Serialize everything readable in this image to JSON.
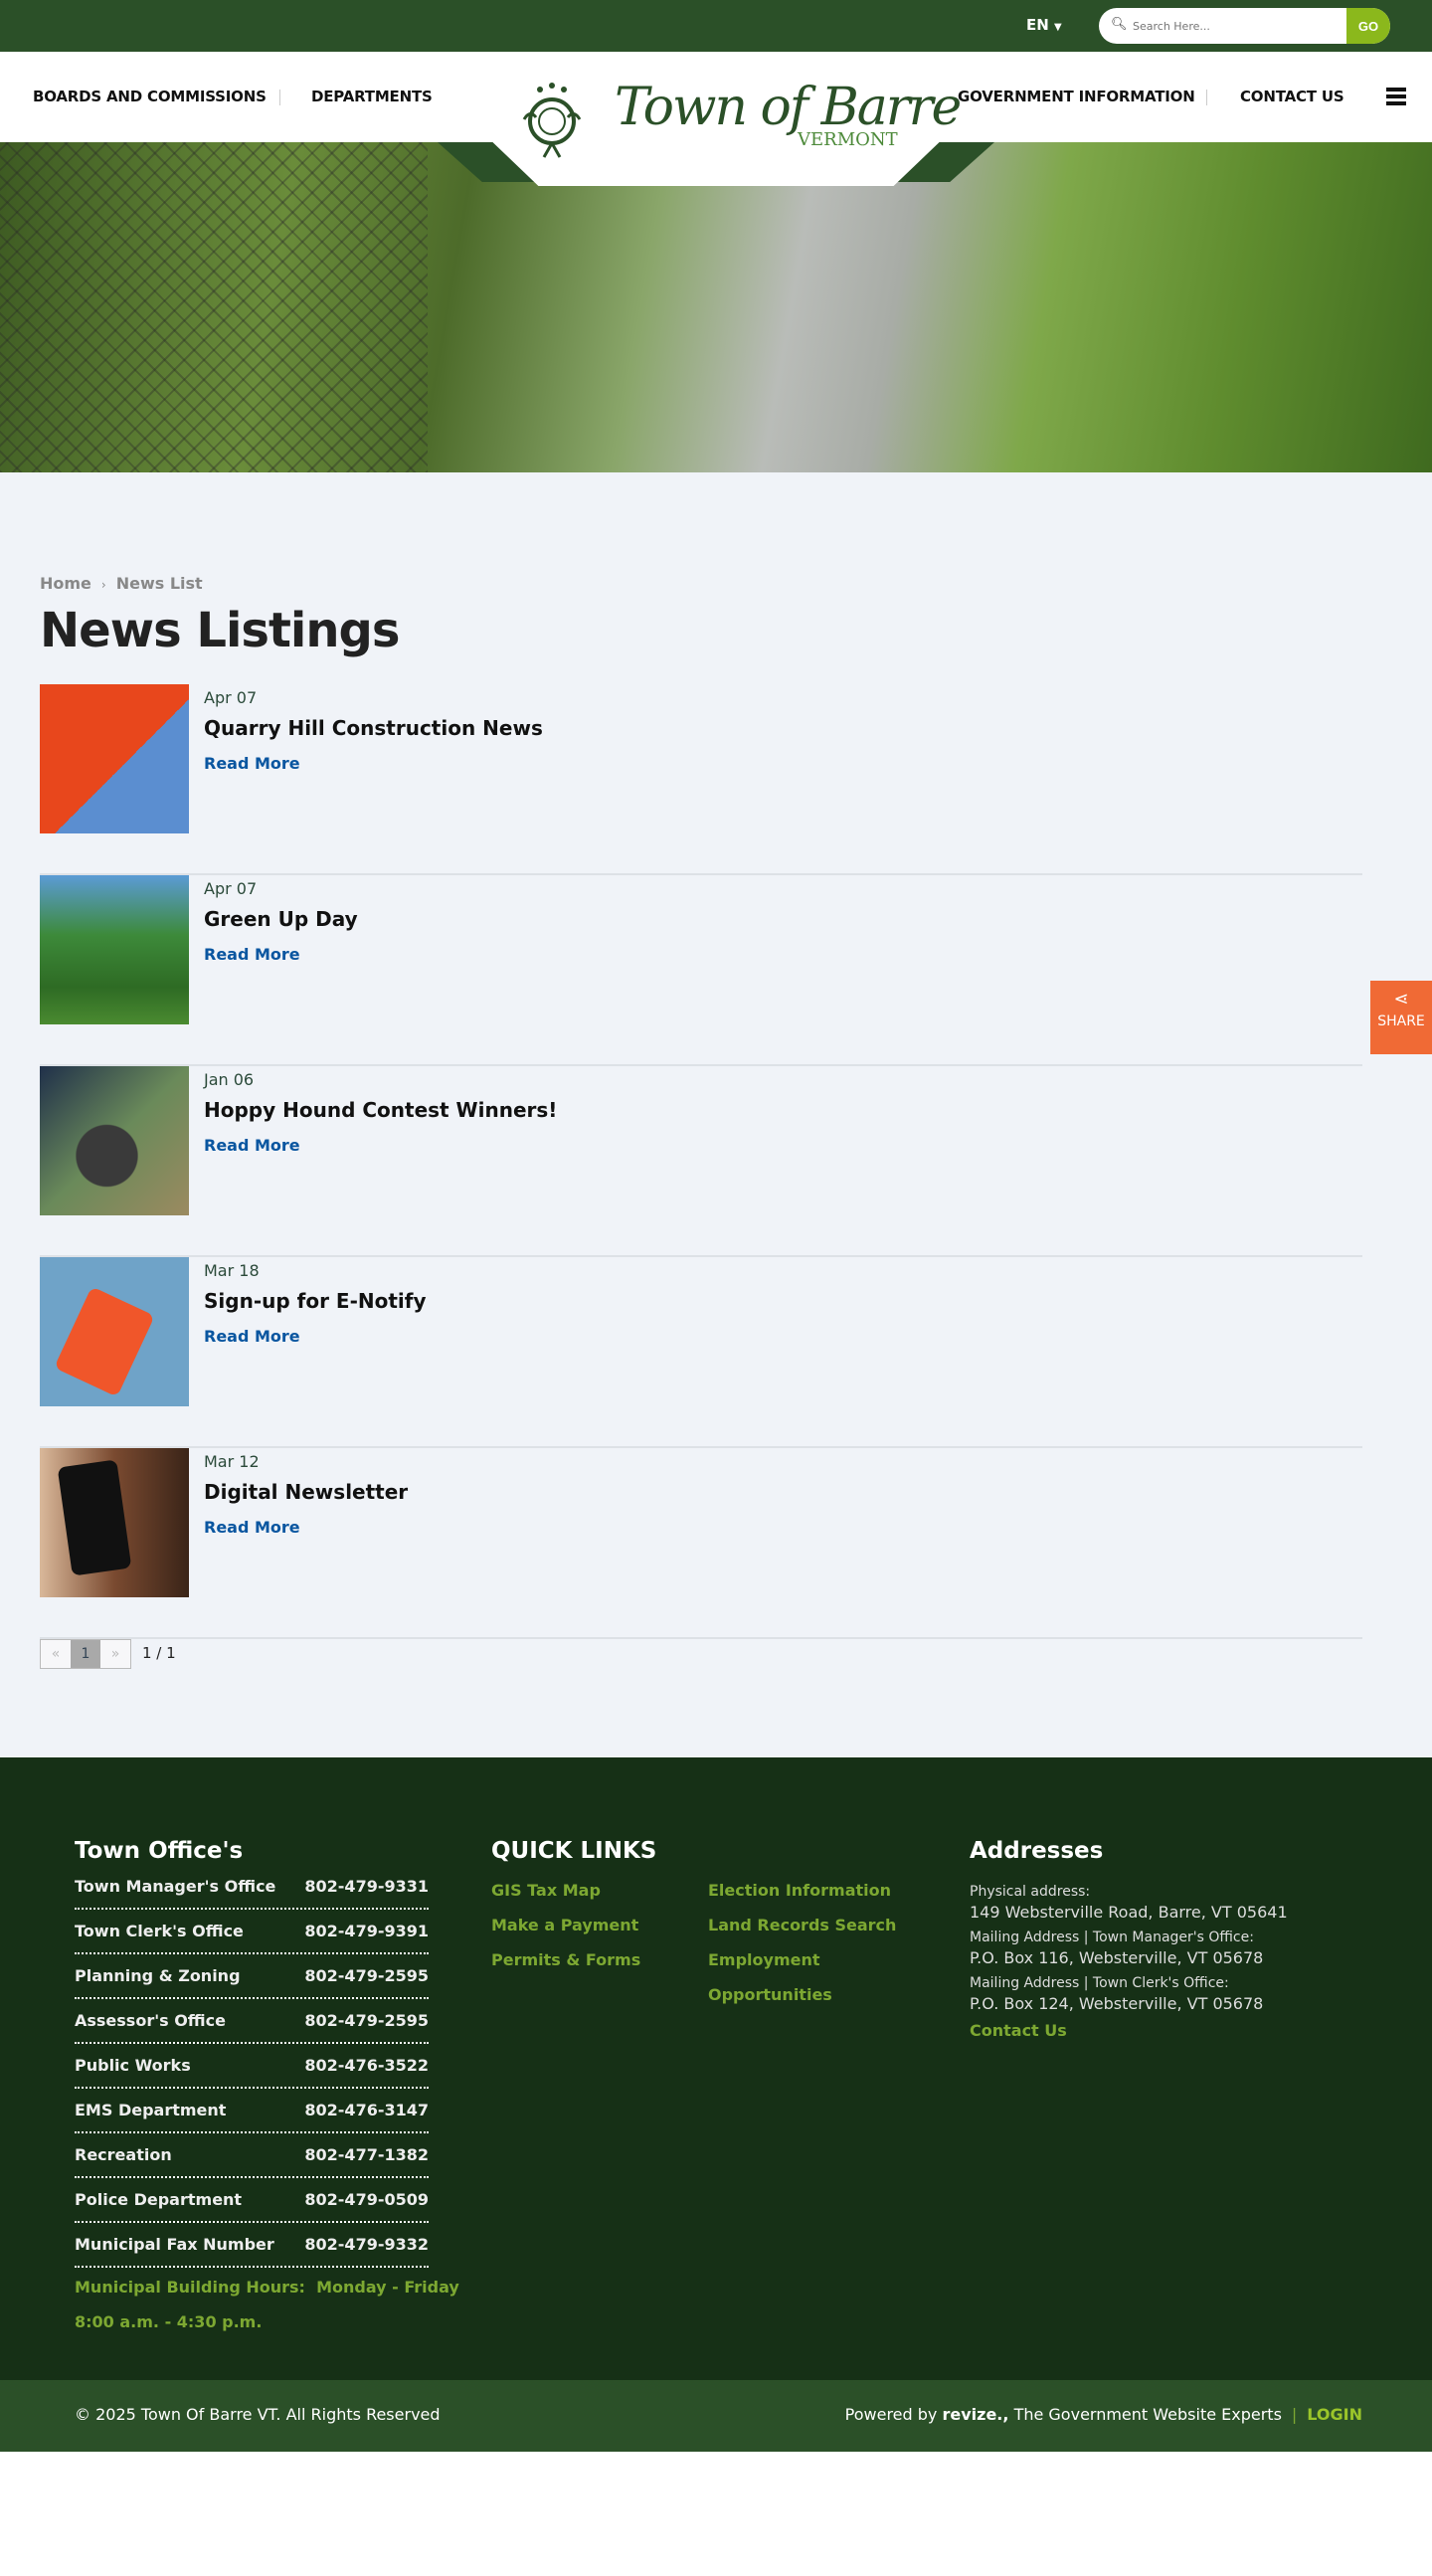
{
  "topbar": {
    "language": "EN",
    "search_placeholder": "Search Here...",
    "search_button": "GO"
  },
  "nav": {
    "left": [
      "BOARDS AND COMMISSIONS",
      "DEPARTMENTS"
    ],
    "right": [
      "GOVERNMENT INFORMATION",
      "CONTACT US"
    ],
    "logo_title": "Town of Barre",
    "logo_subtitle": "VERMONT"
  },
  "breadcrumb": {
    "home": "Home",
    "current": "News List"
  },
  "page_title": "News Listings",
  "news": [
    {
      "date": "Apr 07",
      "title": "Quarry Hill Construction News",
      "link": "Read More"
    },
    {
      "date": "Apr 07",
      "title": "Green Up Day",
      "link": "Read More"
    },
    {
      "date": "Jan 06",
      "title": "Hoppy Hound Contest Winners!",
      "link": "Read More"
    },
    {
      "date": "Mar 18",
      "title": "Sign-up for E-Notify",
      "link": "Read More"
    },
    {
      "date": "Mar 12",
      "title": "Digital Newsletter",
      "link": "Read More"
    }
  ],
  "pagination": {
    "prev": "«",
    "current": "1",
    "next": "»",
    "count": "1 / 1"
  },
  "share": {
    "label": "SHARE"
  },
  "footer": {
    "offices_heading": "Town Office's",
    "offices": [
      {
        "name": "Town Manager's Office",
        "phone": "802-479-9331"
      },
      {
        "name": "Town Clerk's Office",
        "phone": "802-479-9391"
      },
      {
        "name": "Planning & Zoning",
        "phone": "802-479-2595"
      },
      {
        "name": "Assessor's Office",
        "phone": "802-479-2595"
      },
      {
        "name": "Public Works",
        "phone": "802-476-3522"
      },
      {
        "name": "EMS Department",
        "phone": "802-476-3147"
      },
      {
        "name": "Recreation",
        "phone": "802-477-1382"
      },
      {
        "name": "Police Department",
        "phone": "802-479-0509"
      },
      {
        "name": "Municipal Fax Number",
        "phone": "802-479-9332"
      }
    ],
    "hours_line1": "Municipal Building Hours:  Monday - Friday",
    "hours_line2": "8:00 a.m. - 4:30 p.m.",
    "quick_heading": "QUICK LINKS",
    "quick_col1": [
      "GIS Tax Map",
      "Make a Payment",
      "Permits & Forms"
    ],
    "quick_col2": [
      "Election Information",
      "Land Records Search",
      "Employment",
      "Opportunities"
    ],
    "addr_heading": "Addresses",
    "addresses": [
      {
        "label": "Physical address:",
        "value": "149 Websterville Road, Barre, VT 05641"
      },
      {
        "label": "Mailing Address | Town Manager's Office:",
        "value": "P.O. Box 116, Websterville, VT 05678"
      },
      {
        "label": "Mailing Address | Town Clerk's Office:",
        "value": "P.O. Box 124, Websterville, VT 05678"
      }
    ],
    "contact_link": "Contact Us"
  },
  "bottom": {
    "copyright": "© 2025 Town Of Barre VT. All Rights Reserved",
    "powered_prefix": "Powered by",
    "brand": "revize.,",
    "powered_suffix": "The Government Website Experts",
    "login": "LOGIN"
  }
}
